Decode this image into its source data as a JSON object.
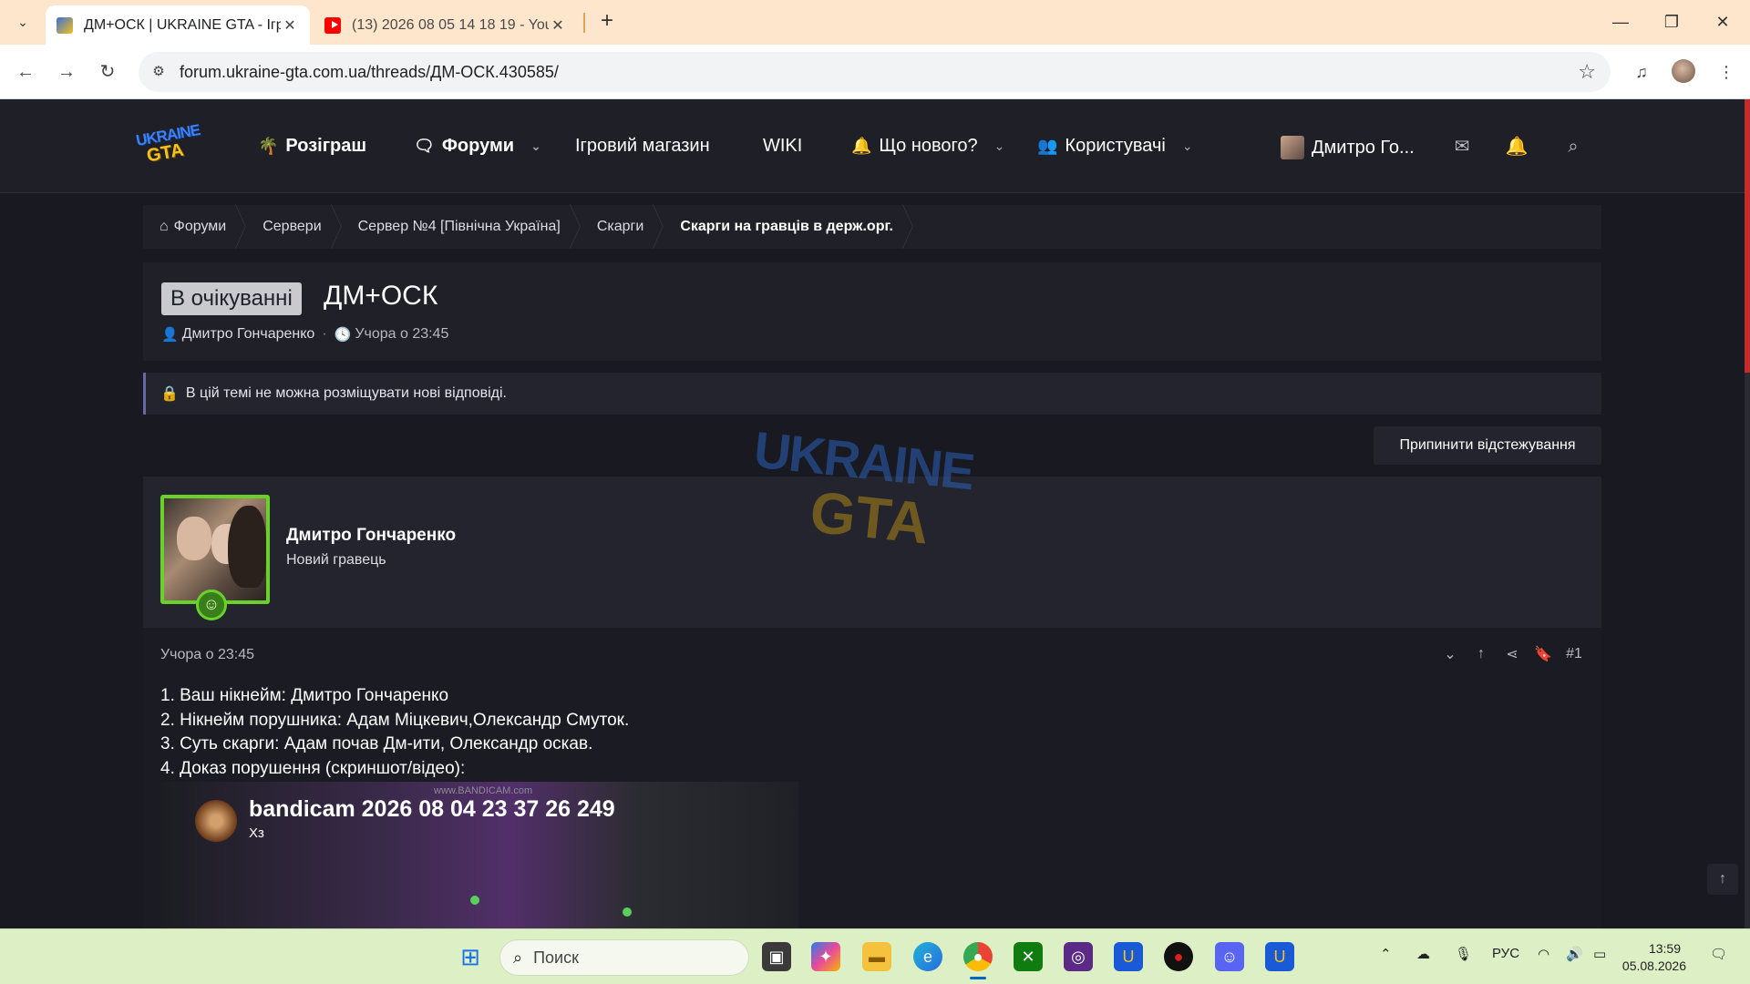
{
  "browser": {
    "tabs": [
      {
        "title": "ДМ+ОСК | UKRAINE GTA - Ігро",
        "active": true
      },
      {
        "title": "(13) 2026 08 05 14 18 19 - YouT",
        "active": false
      }
    ],
    "url": "forum.ukraine-gta.com.ua/threads/ДМ-ОСК.430585/"
  },
  "site": {
    "logo_line1": "UKRAINE",
    "logo_line2": "GTA",
    "nav": [
      {
        "label": "Розіграш",
        "icon": "palm-icon"
      },
      {
        "label": "Форуми",
        "icon": "chat-icon"
      },
      {
        "label": "Ігровий магазин"
      },
      {
        "label": "WIKI"
      },
      {
        "label": "Що нового?",
        "icon": "bell-icon"
      },
      {
        "label": "Користувачі",
        "icon": "users-icon"
      }
    ],
    "user_name": "Дмитро Го..."
  },
  "breadcrumb": [
    "Форуми",
    "Сервери",
    "Сервер №4 [Північна Україна]",
    "Скарги",
    "Скарги на гравців в держ.орг."
  ],
  "thread": {
    "prefix": "В очікуванні",
    "title": "ДМ+ОСК",
    "author": "Дмитро Гончаренко",
    "time": "Учора о 23:45",
    "notice": "В цій темі не можна розміщувати нові відповіді.",
    "unwatch_label": "Припинити відстежування"
  },
  "post": {
    "user_name": "Дмитро Гончаренко",
    "user_title": "Новий гравець",
    "date": "Учора о 23:45",
    "number": "#1",
    "lines": [
      "1. Ваш нікнейм: Дмитро Гончаренко",
      "2. Нікнейм порушника: Адам Міцкевич,Олександр Смуток.",
      "3. Суть скарги: Адам почав Дм-ити, Олександр оскав.",
      "4. Доказ порушення (скриншот/відео):"
    ],
    "video_title": "bandicam 2026 08 04 23 37 26 249",
    "video_sub": "Хз",
    "video_brand": "www.BANDICAM.com",
    "watermark_line1": "UKRAINE",
    "watermark_line2": "GTA"
  },
  "taskbar": {
    "search_placeholder": "Поиск",
    "lang": "РУС",
    "time": "13:59",
    "date": "05.08.2026"
  },
  "colors": {
    "accent_green": "#6ad12a",
    "header_bg": "#1e1f27",
    "page_bg": "#191a21",
    "taskbar_bg": "#ddefc5",
    "tabbar_bg": "#fde6cc"
  }
}
